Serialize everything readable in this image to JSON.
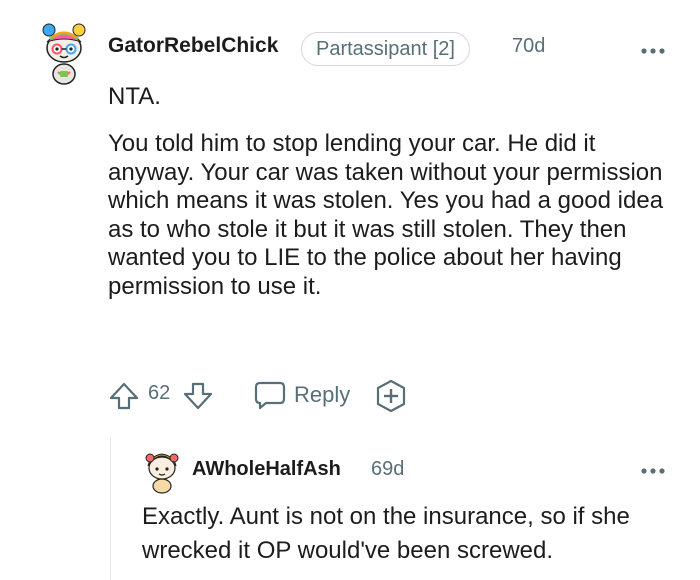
{
  "comment": {
    "username": "GatorRebelChick",
    "flair": "Partassipant [2]",
    "age": "70d",
    "paragraphs": [
      "NTA.",
      "You told him to stop lending your car. He did it anyway. Your car was taken without your permission which means it was stolen. Yes you had a good idea as to who stole it but it was still stolen. They then wanted you to LIE to the police about her having permission to use it."
    ],
    "votes": "62",
    "reply_label": "Reply",
    "icons": {
      "avatar": "snoo-avatar-icon",
      "more": "more-options-icon",
      "upvote": "upvote-arrow-icon",
      "downvote": "downvote-arrow-icon",
      "reply": "speech-bubble-icon",
      "award": "award-plus-icon"
    }
  },
  "reply": {
    "username": "AWholeHalfAsh",
    "age": "69d",
    "text": "Exactly. Aunt is not on the insurance, so if she wrecked it OP would've been screwed.",
    "icons": {
      "avatar": "snoo-avatar-icon",
      "more": "more-options-icon"
    }
  },
  "colors": {
    "text": "#1c1c1c",
    "meta": "#576f76",
    "border": "#d3d6da"
  }
}
